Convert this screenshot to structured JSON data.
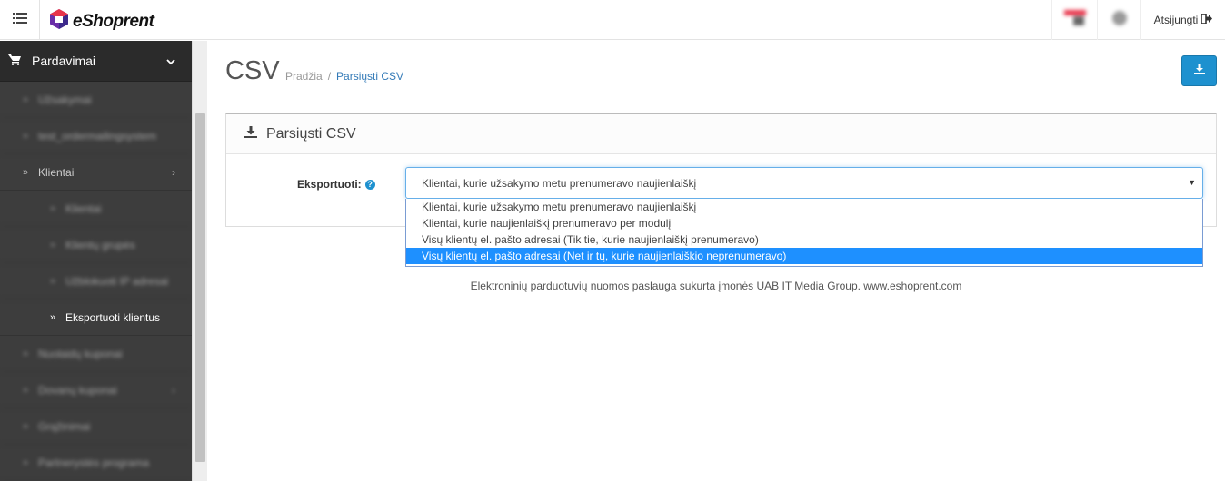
{
  "header": {
    "brand": "eShoprent",
    "logout_label": "Atsijungti"
  },
  "sidebar": {
    "section_label": "Pardavimai",
    "items": [
      {
        "label": "Užsakymai"
      },
      {
        "label": "test_ordermailingsystem"
      },
      {
        "label": "Klientai"
      },
      {
        "label": "Klientai"
      },
      {
        "label": "Klientų grupės"
      },
      {
        "label": "Užblokuoti IP adresai"
      },
      {
        "label": "Eksportuoti klientus"
      },
      {
        "label": "Nuolaidų kuponai"
      },
      {
        "label": "Dovanų kuponai"
      },
      {
        "label": "Grąžinimai"
      },
      {
        "label": "Partnerystės programa"
      }
    ]
  },
  "page": {
    "title": "CSV",
    "breadcrumb": [
      {
        "label": "Pradžia"
      },
      {
        "label": "Parsiųsti CSV"
      }
    ],
    "breadcrumb_sep": "/"
  },
  "panel": {
    "heading": "Parsiųsti CSV",
    "export_label": "Eksportuoti:",
    "help_glyph": "?",
    "selected_value": "Klientai, kurie užsakymo metu prenumeravo naujienlaiškį",
    "options": [
      "Klientai, kurie užsakymo metu prenumeravo naujienlaiškį",
      "Klientai, kurie naujienlaiškį prenumeravo per modulį",
      "Visų klientų el. pašto adresai (Tik tie, kurie naujienlaiškį prenumeravo)",
      "Visų klientų el. pašto adresai (Net ir tų, kurie naujienlaiškio neprenumeravo)"
    ]
  },
  "footer": {
    "text": "Elektroninių parduotuvių nuomos paslauga sukurta įmonės UAB IT Media Group. www.eshoprent.com"
  },
  "colors": {
    "accent": "#1e91cf",
    "sidebar_bg": "#3d3d3d",
    "selected_option": "#1e90ff"
  }
}
